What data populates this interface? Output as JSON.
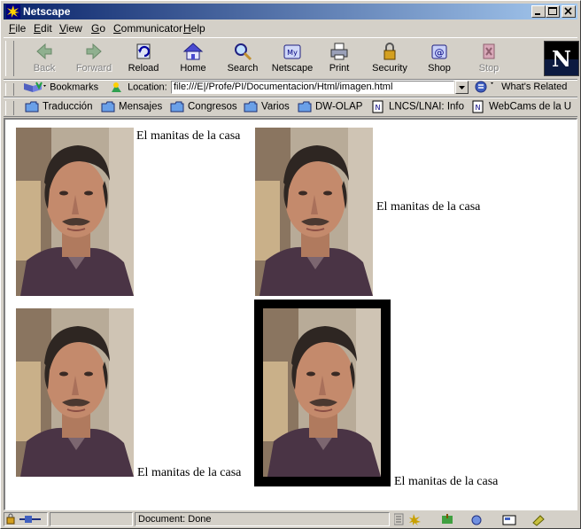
{
  "window": {
    "title": "Netscape"
  },
  "menu": [
    {
      "label": "File",
      "key": "F",
      "rest": "ile"
    },
    {
      "label": "Edit",
      "key": "E",
      "rest": "dit"
    },
    {
      "label": "View",
      "key": "V",
      "rest": "iew"
    },
    {
      "label": "Go",
      "key": "G",
      "rest": "o"
    },
    {
      "label": "Communicator",
      "key": "C",
      "rest": "ommunicator"
    },
    {
      "label": "Help",
      "key": "H",
      "rest": "elp"
    }
  ],
  "nav_toolbar": {
    "buttons": [
      {
        "label": "Back",
        "icon": "back-arrow-icon",
        "enabled": false
      },
      {
        "label": "Forward",
        "icon": "forward-arrow-icon",
        "enabled": false
      },
      {
        "label": "Reload",
        "icon": "reload-icon",
        "enabled": true
      },
      {
        "label": "Home",
        "icon": "home-icon",
        "enabled": true
      },
      {
        "label": "Search",
        "icon": "search-icon",
        "enabled": true
      },
      {
        "label": "Netscape",
        "icon": "netscape-icon",
        "enabled": true
      },
      {
        "label": "Print",
        "icon": "printer-icon",
        "enabled": true
      },
      {
        "label": "Security",
        "icon": "padlock-icon",
        "enabled": true
      },
      {
        "label": "Shop",
        "icon": "shop-icon",
        "enabled": true
      },
      {
        "label": "Stop",
        "icon": "stop-icon",
        "enabled": false
      }
    ],
    "logo_letter": "N"
  },
  "location_toolbar": {
    "bookmarks_label": "Bookmarks",
    "location_label": "Location:",
    "url": "file:///E|/Profe/PI/Documentacion/Html/imagen.html",
    "whats_related_label": "What's Related"
  },
  "personal_toolbar": {
    "items": [
      {
        "label": "Traducción",
        "icon": "folder-icon"
      },
      {
        "label": "Mensajes",
        "icon": "folder-icon"
      },
      {
        "label": "Congresos",
        "icon": "folder-icon"
      },
      {
        "label": "Varios",
        "icon": "folder-icon"
      },
      {
        "label": "DW-OLAP",
        "icon": "folder-icon"
      },
      {
        "label": "LNCS/LNAI: Info",
        "icon": "page-icon"
      },
      {
        "label": "WebCams de la U",
        "icon": "page-icon"
      }
    ]
  },
  "page": {
    "figures": [
      {
        "caption": "El manitas de la casa",
        "alignment": "top"
      },
      {
        "caption": "El manitas de la casa",
        "alignment": "middle"
      },
      {
        "caption": "El manitas de la casa",
        "alignment": "bottom"
      },
      {
        "caption": "El manitas de la casa",
        "alignment": "bottom-with-border"
      }
    ]
  },
  "status": {
    "text": "Document: Done"
  },
  "colors": {
    "titlebar_start": "#0a246a",
    "titlebar_end": "#a6caf0",
    "chrome": "#d4d0c8",
    "content_bg": "#ffffff"
  }
}
